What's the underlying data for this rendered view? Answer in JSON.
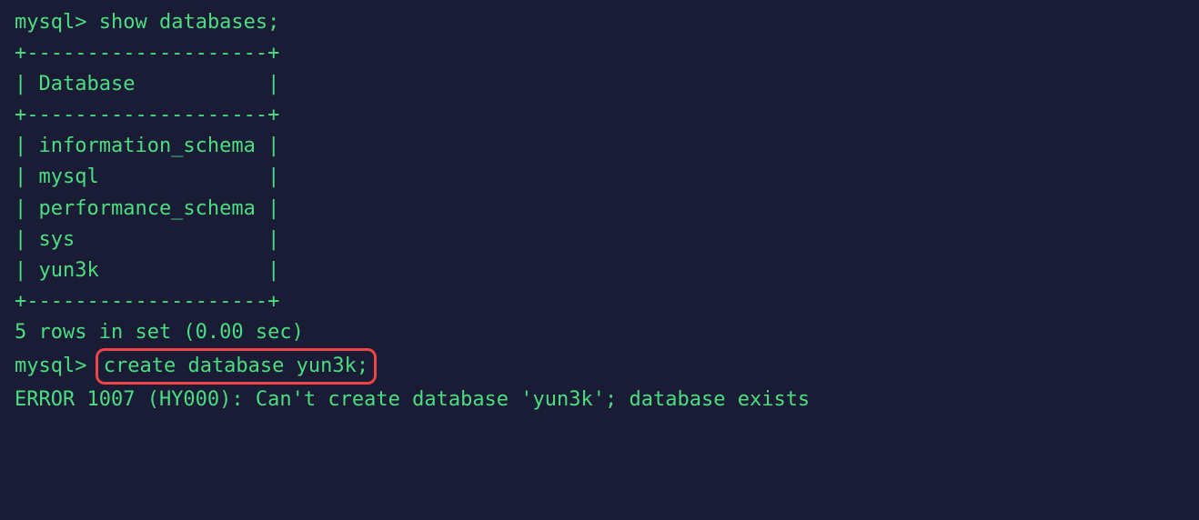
{
  "terminal": {
    "prompt": "mysql>",
    "cmd1": "show databases;",
    "table": {
      "border_top": "+--------------------+",
      "header": "| Database           |",
      "border_mid": "+--------------------+",
      "row1": "| information_schema |",
      "row2": "| mysql              |",
      "row3": "| performance_schema |",
      "row4": "| sys                |",
      "row5": "| yun3k              |",
      "border_bottom": "+--------------------+"
    },
    "result": "5 rows in set (0.00 sec)",
    "blank": "",
    "cmd2": "create database yun3k;",
    "error": "ERROR 1007 (HY000): Can't create database 'yun3k'; database exists"
  }
}
